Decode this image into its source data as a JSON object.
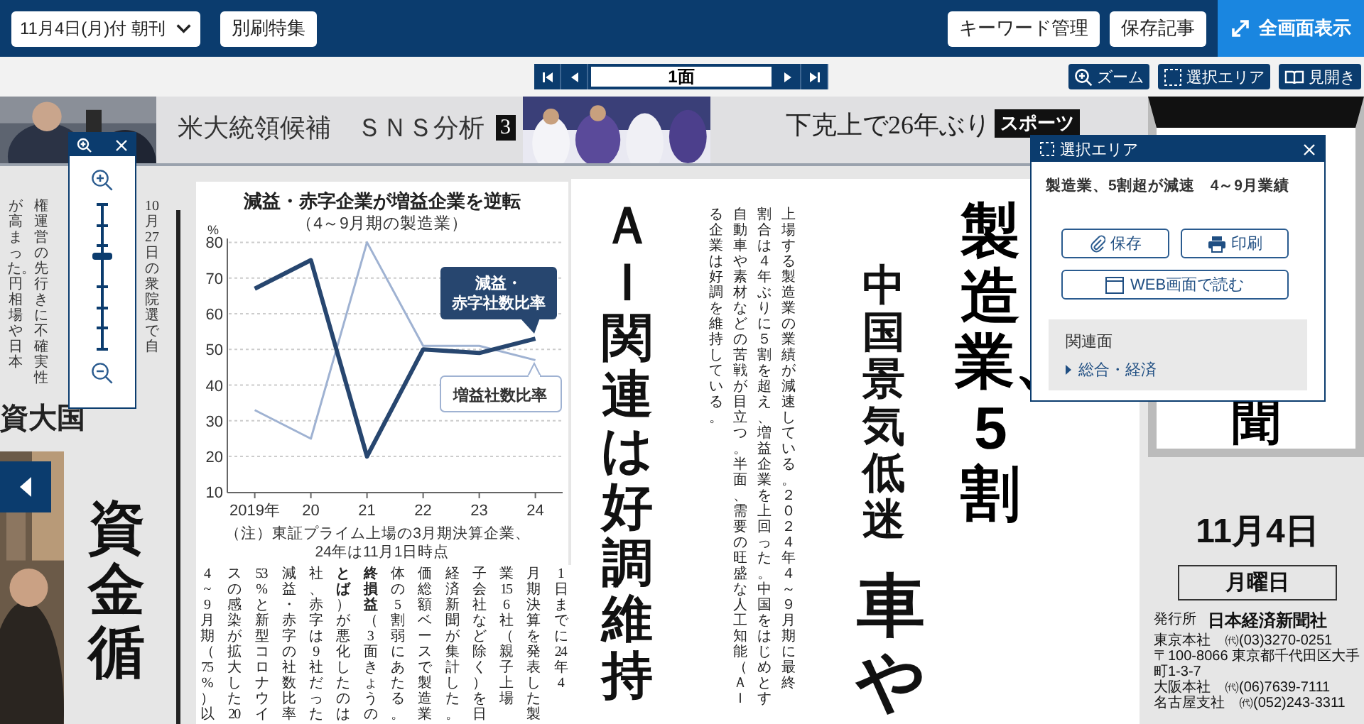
{
  "toolbar": {
    "edition": "11月4日(月)付 朝刊",
    "supplement": "別刷特集",
    "keyword": "キーワード管理",
    "saved": "保存記事",
    "fullscreen": "全画面表示"
  },
  "pager": {
    "page": "1面"
  },
  "view_tools": [
    {
      "kind": "zoom",
      "label": "ズーム"
    },
    {
      "kind": "select",
      "label": "選択エリア"
    },
    {
      "kind": "spread",
      "label": "見開き"
    }
  ],
  "zoom_panel": {
    "level": 0.64
  },
  "newspaper": {
    "top_banner": {
      "text": "米大統領候補　ＳＮＳ分析",
      "badge": "3"
    },
    "sports_banner": {
      "text": "下克上で26年ぶり",
      "badge": "スポーツ"
    },
    "left_columns": [
      "が高まった。円相場や日本",
      "権運営の先行きに不確実性",
      "10月27日の衆院選で自"
    ],
    "left_heading": "資大国",
    "left_headline": "資金循",
    "chart": {
      "subtitle": "（4～9月期の製造業）",
      "note": [
        "（注）東証プライム上場の3月期決算企業、",
        "24年は11月1日時点"
      ],
      "chart_data": {
        "type": "line",
        "grid": true,
        "title": "減益・赤字企業が増益企業を逆転",
        "ylabel": "%",
        "categories": [
          "2019年",
          "20",
          "21",
          "22",
          "23",
          "24"
        ],
        "ylim": [
          10,
          80
        ],
        "yticks": [
          10,
          20,
          30,
          40,
          50,
          60,
          70,
          80
        ],
        "series": [
          {
            "name": "減益・赤字社数比率",
            "color": "#27466f",
            "values": [
              67,
              75,
              20,
              50,
              49,
              53
            ]
          },
          {
            "name": "増益社数比率",
            "color": "#9fb2d2",
            "values": [
              33,
              25,
              80,
              51,
              51,
              47
            ]
          }
        ]
      }
    },
    "body_columns": [
      "4~9月期（75%）以",
      "スの感染が拡大した20",
      "53%と新型コロナウイ",
      "減益・赤字の社数比率",
      "社、赤字は9社だった",
      "**とば**）が悪化したのは",
      "**終損益**（3面きょうの",
      "体の5割弱にあたる。",
      "価総額ベースで製造業",
      "経済新聞が集計した。",
      "子会社など除く）を日",
      "業156社（親子上場",
      "月期決算を発表した製",
      "1日までに24年4"
    ],
    "headline": "ＡＩ関連は好調維持",
    "lead_columns": [
      "る企業は好調を維持している。",
      "自動車や素材などの苦戦が目立つ。半面、需要の旺盛な人工知能（ＡＩ",
      "割合は４年ぶりに５割を超え、増益企業を上回った。中国をはじめとす",
      "上場する製造業の業績が減速している。２０２４年４～９月期に最終"
    ],
    "subheadline": "中国景気低迷",
    "subheadline_cont": "車や",
    "main_headline": "製造業、5割",
    "masthead": {
      "logo_part": "聞",
      "date": "11月4日",
      "weekday": "月曜日",
      "publisher_label": "発行所",
      "publisher": "日本経済新聞社",
      "offices": [
        "東京本社　㈹(03)3270-0251",
        "〒100-8066 東京都千代田区大手町1-3-7",
        "大阪本社　㈹(06)7639-7111",
        "名古屋支社　㈹(052)243-3311"
      ]
    }
  },
  "selection_panel": {
    "title": "選択エリア",
    "article": "製造業、5割超が減速　4～9月業績",
    "save": "保存",
    "print": "印刷",
    "web": "WEB画面で読む",
    "related_label": "関連面",
    "related_link": "総合・経済"
  }
}
